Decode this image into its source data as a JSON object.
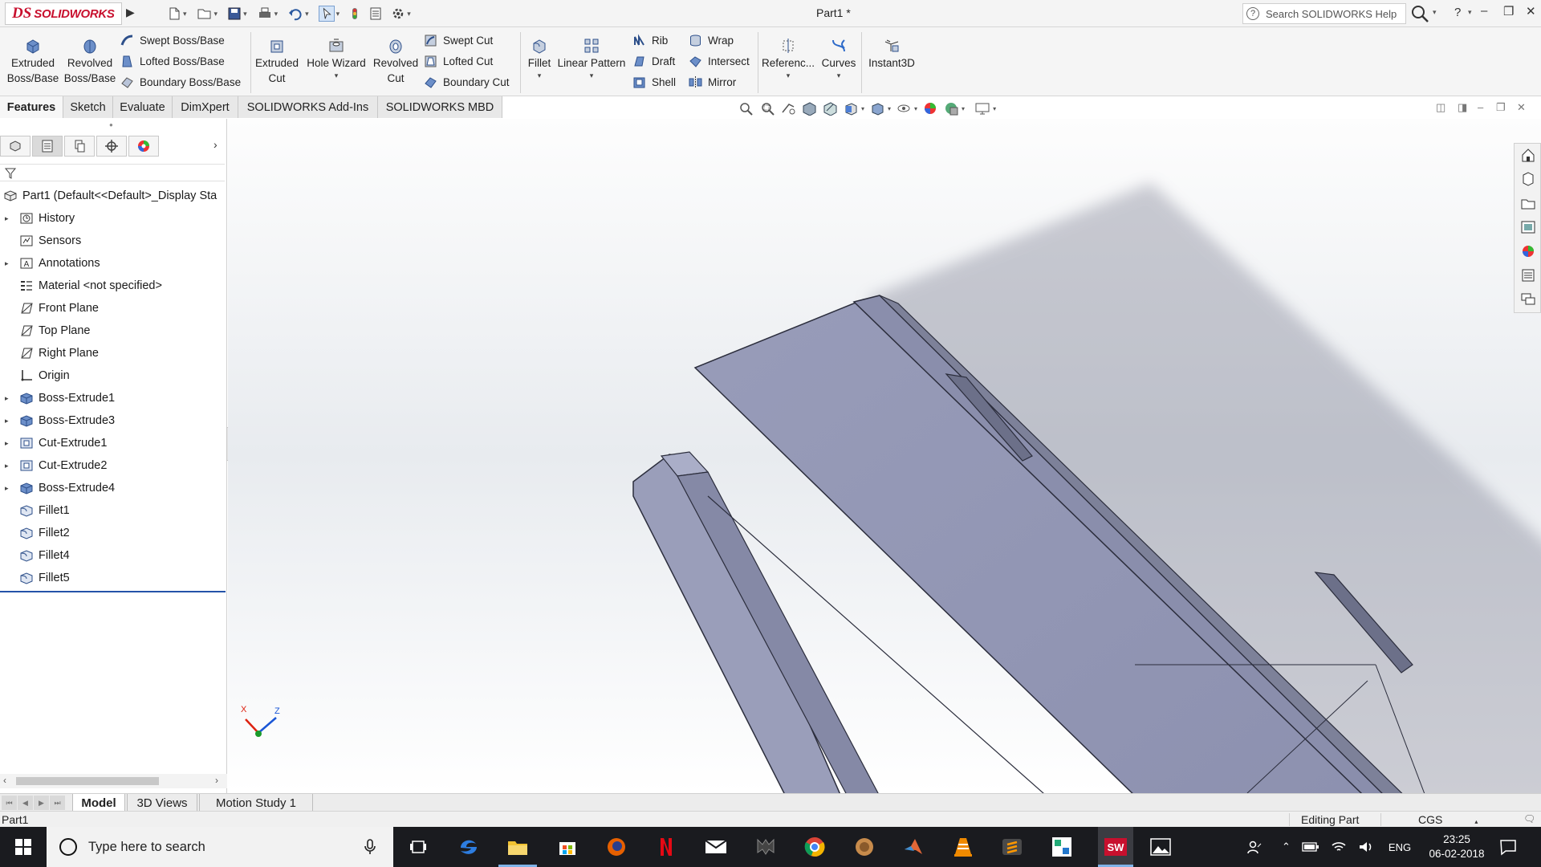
{
  "titlebar": {
    "app_name": "SOLIDWORKS",
    "logo_letters": "DS",
    "document_title": "Part1 *",
    "search_placeholder": "Search SOLIDWORKS Help",
    "help_label": "?",
    "quick_access_icons": [
      "new-document-icon",
      "open-icon",
      "save-icon",
      "print-icon",
      "undo-icon",
      "select-icon",
      "rebuild-icon",
      "file-properties-icon",
      "options-icon"
    ]
  },
  "command_manager": {
    "extruded_boss": "Extruded\nBoss/Base",
    "revolved_boss": "Revolved\nBoss/Base",
    "swept_boss": "Swept Boss/Base",
    "lofted_boss": "Lofted Boss/Base",
    "boundary_boss": "Boundary Boss/Base",
    "extruded_cut": "Extruded\nCut",
    "hole_wizard": "Hole Wizard",
    "revolved_cut": "Revolved\nCut",
    "swept_cut": "Swept Cut",
    "lofted_cut": "Lofted Cut",
    "boundary_cut": "Boundary Cut",
    "fillet": "Fillet",
    "linear_pattern": "Linear Pattern",
    "rib": "Rib",
    "draft": "Draft",
    "shell": "Shell",
    "wrap": "Wrap",
    "intersect": "Intersect",
    "mirror": "Mirror",
    "reference": "Referenc...",
    "curves": "Curves",
    "instant3d": "Instant3D"
  },
  "tabs": [
    {
      "label": "Features",
      "active": true
    },
    {
      "label": "Sketch",
      "active": false
    },
    {
      "label": "Evaluate",
      "active": false
    },
    {
      "label": "DimXpert",
      "active": false
    },
    {
      "label": "SOLIDWORKS Add-Ins",
      "active": false
    },
    {
      "label": "SOLIDWORKS MBD",
      "active": false
    }
  ],
  "feature_tree": {
    "root": "Part1  (Default<<Default>_Display Sta",
    "nodes": [
      {
        "label": "History",
        "expandable": true,
        "icon": "history-icon"
      },
      {
        "label": "Sensors",
        "expandable": false,
        "icon": "sensors-icon"
      },
      {
        "label": "Annotations",
        "expandable": true,
        "icon": "annotations-icon"
      },
      {
        "label": "Material <not specified>",
        "expandable": false,
        "icon": "material-icon"
      },
      {
        "label": "Front Plane",
        "expandable": false,
        "icon": "plane-icon"
      },
      {
        "label": "Top Plane",
        "expandable": false,
        "icon": "plane-icon"
      },
      {
        "label": "Right Plane",
        "expandable": false,
        "icon": "plane-icon"
      },
      {
        "label": "Origin",
        "expandable": false,
        "icon": "origin-icon"
      },
      {
        "label": "Boss-Extrude1",
        "expandable": true,
        "icon": "boss-extrude-icon"
      },
      {
        "label": "Boss-Extrude3",
        "expandable": true,
        "icon": "boss-extrude-icon"
      },
      {
        "label": "Cut-Extrude1",
        "expandable": true,
        "icon": "cut-extrude-icon"
      },
      {
        "label": "Cut-Extrude2",
        "expandable": true,
        "icon": "cut-extrude-icon"
      },
      {
        "label": "Boss-Extrude4",
        "expandable": true,
        "icon": "boss-extrude-icon"
      },
      {
        "label": "Fillet1",
        "expandable": false,
        "icon": "fillet-icon"
      },
      {
        "label": "Fillet2",
        "expandable": false,
        "icon": "fillet-icon"
      },
      {
        "label": "Fillet4",
        "expandable": false,
        "icon": "fillet-icon"
      },
      {
        "label": "Fillet5",
        "expandable": false,
        "icon": "fillet-icon"
      }
    ]
  },
  "triad": {
    "x": "X",
    "z": "Z"
  },
  "bottom_tabs": [
    {
      "label": "Model",
      "active": true
    },
    {
      "label": "3D Views",
      "active": false
    },
    {
      "label": "Motion Study 1",
      "active": false
    }
  ],
  "status": {
    "document": "Part1",
    "mode": "Editing Part",
    "units": "CGS"
  },
  "taskbar": {
    "search_placeholder": "Type here to search",
    "language": "ENG",
    "time": "23:25",
    "date": "06-02-2018",
    "apps": [
      "task-view-icon",
      "edge-icon",
      "file-explorer-icon",
      "store-icon",
      "firefox-icon",
      "netflix-icon",
      "mail-icon",
      "game-icon",
      "chrome-icon",
      "media-icon",
      "matlab-icon",
      "vlc-icon",
      "sublime-icon",
      "photo-editor-icon",
      "solidworks-icon",
      "photos-icon"
    ]
  },
  "colors": {
    "brand": "#c8102e",
    "model_face": "#8f94b3",
    "taskbar": "#1a1b1f",
    "rollback_bar": "#2553a8"
  }
}
